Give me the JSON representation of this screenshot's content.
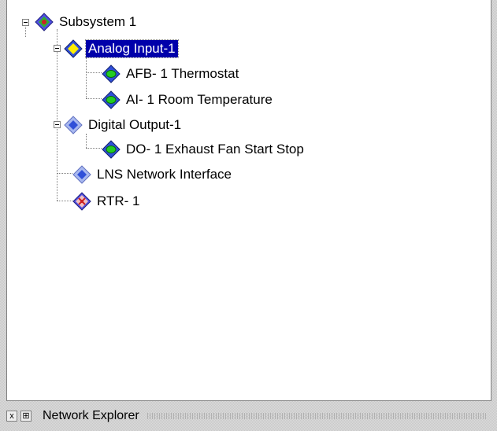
{
  "tree": {
    "root": {
      "label": "Subsystem 1",
      "icon": "subsystem-icon"
    },
    "items": [
      {
        "label": "Analog Input-1",
        "icon": "functional-block-yellow-icon",
        "selected": true
      },
      {
        "label": "AFB- 1 Thermostat",
        "icon": "device-green-icon"
      },
      {
        "label": "AI- 1 Room Temperature",
        "icon": "device-green-icon"
      },
      {
        "label": "Digital Output-1",
        "icon": "functional-block-blue-icon"
      },
      {
        "label": "DO- 1 Exhaust Fan Start Stop",
        "icon": "device-green-icon"
      },
      {
        "label": "LNS Network Interface",
        "icon": "network-interface-icon"
      },
      {
        "label": "RTR- 1",
        "icon": "router-icon"
      }
    ]
  },
  "status_bar": {
    "close_glyph": "x",
    "pin_glyph": "⊞",
    "title": "Network Explorer"
  },
  "colors": {
    "selection": "#0000aa",
    "diamond_blue": "#3050d8",
    "diamond_yellow": "#ffee00",
    "device_green": "#22cc22",
    "router_red": "#cc2222"
  }
}
